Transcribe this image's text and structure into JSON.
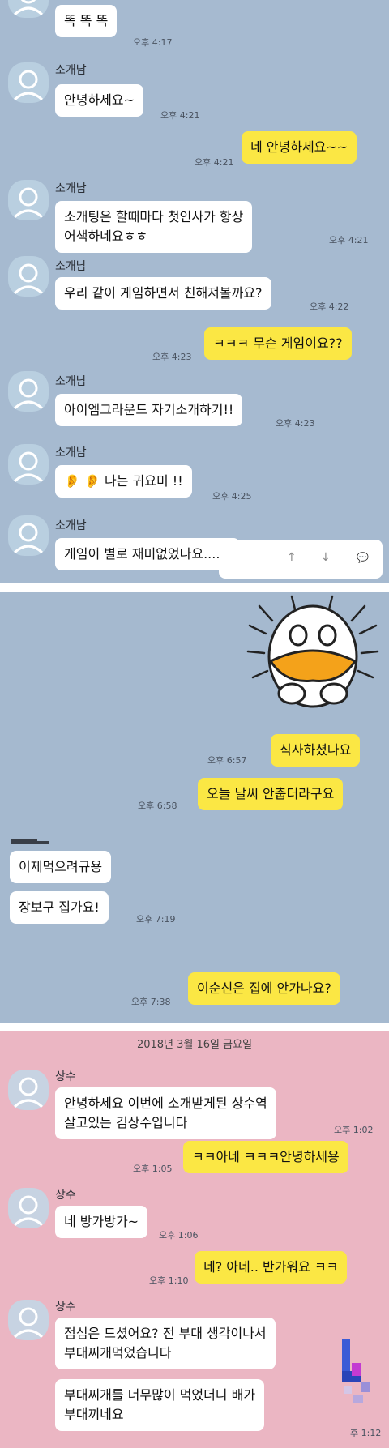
{
  "panel1": {
    "messages": [
      {
        "side": "in",
        "text": "똑 똑 똑",
        "time": "오후 4:17"
      },
      {
        "side": "in",
        "name": "소개남",
        "text": "안녕하세요~",
        "time": "오후 4:21"
      },
      {
        "side": "out",
        "text": "네 안녕하세요~~",
        "time": "오후 4:21"
      },
      {
        "side": "in",
        "name": "소개남",
        "line1": "소개팅은 할때마다 첫인사가 항상",
        "line2": "어색하네요ㅎㅎ",
        "time": "오후 4:21"
      },
      {
        "side": "in",
        "name": "소개남",
        "text": "우리 같이 게임하면서 친해져볼까요?",
        "time": "오후 4:22"
      },
      {
        "side": "out",
        "text": "ㅋㅋㅋ 무슨 게임이요??",
        "time": "오후 4:23"
      },
      {
        "side": "in",
        "name": "소개남",
        "text": "아이엠그라운드 자기소개하기!!",
        "time": "오후 4:23"
      },
      {
        "side": "in",
        "name": "소개남",
        "text": "👂 👂 나는 귀요미 !!",
        "time": "오후 4:25"
      },
      {
        "side": "in",
        "name": "소개남",
        "text": "게임이 별로 재미없었나요.....?"
      }
    ],
    "input_icons": {
      "up": "↑",
      "down": "↓",
      "chat": "💬"
    }
  },
  "panel2": {
    "messages": [
      {
        "side": "out",
        "text": "식사하셨나요",
        "time": "오후 6:57"
      },
      {
        "side": "out",
        "text": "오늘 날씨 안춥더라구요",
        "time": "오후 6:58"
      },
      {
        "side": "in",
        "text": "이제먹으려규용"
      },
      {
        "side": "in",
        "text": "장보구 집가요!",
        "time": "오후 7:19"
      },
      {
        "side": "out",
        "text": "이순신은 집에 안가나요?",
        "time": "오후 7:38"
      }
    ]
  },
  "panel3": {
    "date": "2018년 3월 16일 금요일",
    "messages": [
      {
        "side": "in",
        "name": "상수",
        "line1": "안녕하세요 이번에 소개받게된 상수역",
        "line2": "살고있는 김상수입니다",
        "time": "오후 1:02"
      },
      {
        "side": "out",
        "text": "ㅋㅋ아네 ㅋㅋㅋ안녕하세용",
        "time": "오후 1:05"
      },
      {
        "side": "in",
        "name": "상수",
        "text": "네 방가방가~",
        "time": "오후 1:06"
      },
      {
        "side": "out",
        "text": "네? 아네.. 반가워요 ㅋㅋ",
        "time": "오후 1:10"
      },
      {
        "side": "in",
        "name": "상수",
        "line1": "점심은 드셨어요? 전 부대 생각이나서",
        "line2": "부대찌개먹었습니다"
      },
      {
        "side": "in",
        "line1": "부대찌개를 너무많이 먹었더니 배가",
        "line2": "부대끼네요",
        "time": "후 1:12"
      }
    ]
  },
  "colors": {
    "blue_bg": "#a6bad0",
    "pink_bg": "#ebb6c3",
    "yellow_bubble": "#fbe744",
    "white_bubble": "#ffffff"
  }
}
